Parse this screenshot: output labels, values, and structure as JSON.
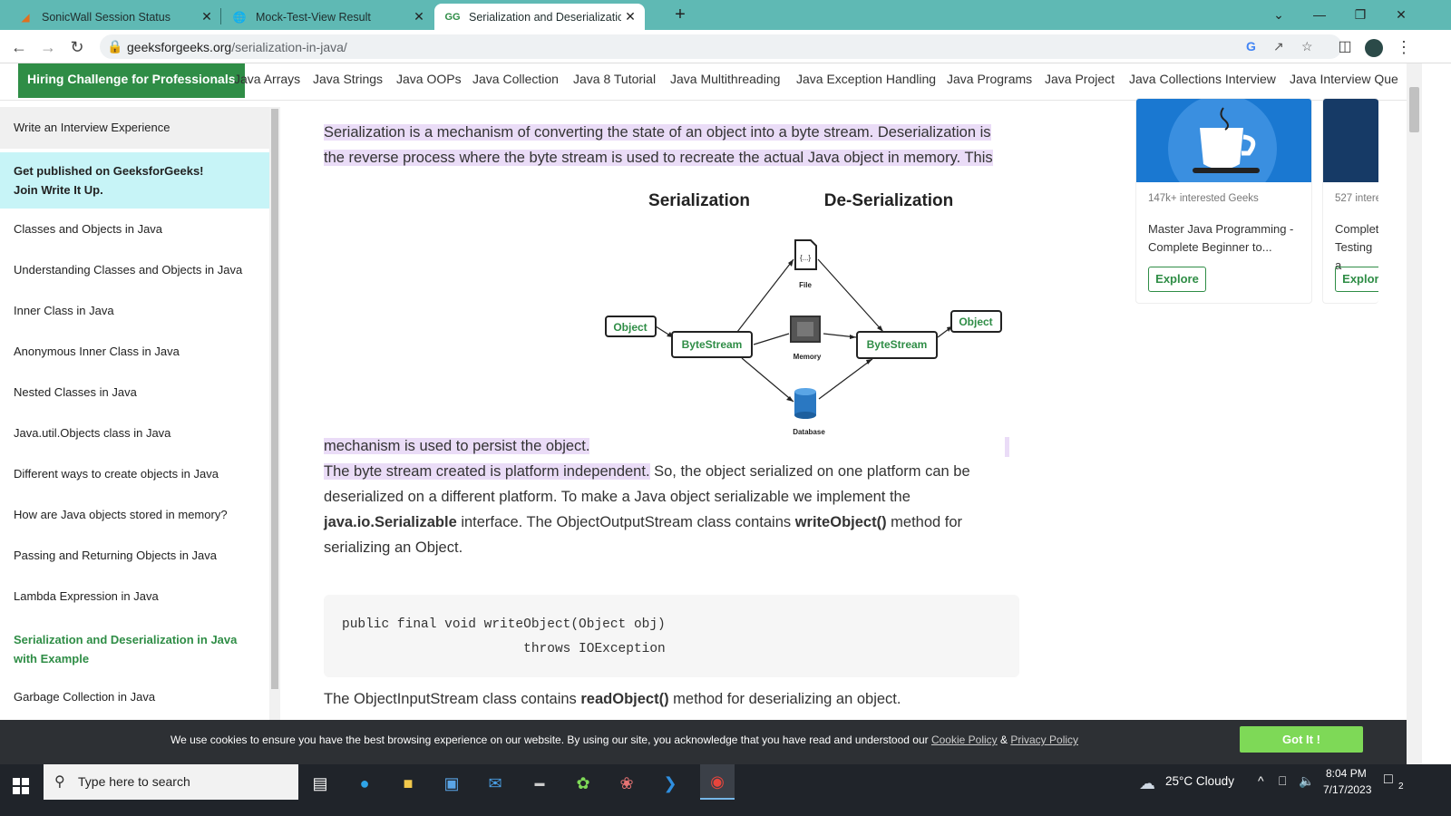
{
  "browser": {
    "tabs": [
      {
        "title": "SonicWall Session Status",
        "icon": "sonicwall-icon"
      },
      {
        "title": "Mock-Test-View Result",
        "icon": "globe-icon"
      },
      {
        "title": "Serialization and Deserialization i",
        "icon": "gfg-icon"
      }
    ],
    "url_domain": "geeksforgeeks.org",
    "url_path": "/serialization-in-java/"
  },
  "nav": {
    "hiring": "Hiring Challenge for Professionals",
    "links": [
      "Java Arrays",
      "Java Strings",
      "Java OOPs",
      "Java Collection",
      "Java 8 Tutorial",
      "Java Multithreading",
      "Java Exception Handling",
      "Java Programs",
      "Java Project",
      "Java Collections Interview",
      "Java Interview Que"
    ]
  },
  "sidebar": {
    "write": "Write an Interview Experience",
    "publish_line1": "Get published on GeeksforGeeks!",
    "publish_line2": "Join Write It Up.",
    "items": [
      "Classes and Objects in Java",
      "Understanding Classes and Objects in Java",
      "Inner Class in Java",
      "Anonymous Inner Class in Java",
      "Nested Classes in Java",
      "Java.util.Objects class in Java",
      "Different ways to create objects in Java",
      "How are Java objects stored in memory?",
      "Passing and Returning Objects in Java",
      "Lambda Expression in Java",
      "Serialization and Deserialization in Java with Example",
      "Garbage Collection in Java"
    ]
  },
  "article": {
    "p1_line1": "Serialization is a mechanism of converting the state of an object into a byte stream. Deserialization is",
    "p1_line2": "the reverse process where the byte stream is used to recreate the actual Java object in memory. This",
    "p1_line3": "mechanism is used to persist the object.",
    "p2_highlight": "The byte stream created is platform independent.",
    "p2_rest1": " So, the object serialized on one platform can be",
    "p2_line2": "deserialized on a different platform. To make a Java object serializable we implement the",
    "p2_bold1": "java.io.Serializable",
    "p2_mid": " interface. The ObjectOutputStream class contains ",
    "p2_bold2": "writeObject()",
    "p2_end": " method for",
    "p2_line4": "serializing an Object.",
    "code_line1": "public final void writeObject(Object obj)",
    "code_line2": "                       throws IOException",
    "p3_start": "The ObjectInputStream class contains ",
    "p3_bold": "readObject()",
    "p3_end": " method for deserializing an object."
  },
  "diagram": {
    "heading_left": "Serialization",
    "heading_right": "De-Serialization",
    "object_left": "Object",
    "bytestream_left": "ByteStream",
    "file": "File",
    "file_glyph": "{...}",
    "memory": "Memory",
    "database": "Database",
    "bytestream_right": "ByteStream",
    "object_right": "Object"
  },
  "cards": [
    {
      "meta": "147k+ interested Geeks",
      "title": "Master Java Programming - Complete Beginner to...",
      "button": "Explore"
    },
    {
      "meta": "527 intere",
      "title": "Complet Testing a",
      "button": "Explore"
    }
  ],
  "cookie": {
    "text": "We use cookies to ensure you have the best browsing experience on our website. By using our site, you acknowledge that you have read and understood our ",
    "cookie_policy": "Cookie Policy",
    "amp": " & ",
    "privacy_policy": "Privacy Policy",
    "button": "Got It !"
  },
  "taskbar": {
    "search_placeholder": "Type here to search",
    "weather": "25°C  Cloudy",
    "time": "8:04 PM",
    "date": "7/17/2023",
    "notifications": "2"
  },
  "colors": {
    "tabstrip": "#5fb9b4",
    "gfg_green": "#2f8d46",
    "highlight": "#eadcf7",
    "cookie_bg": "#2d3034",
    "got_it": "#7ed957"
  }
}
